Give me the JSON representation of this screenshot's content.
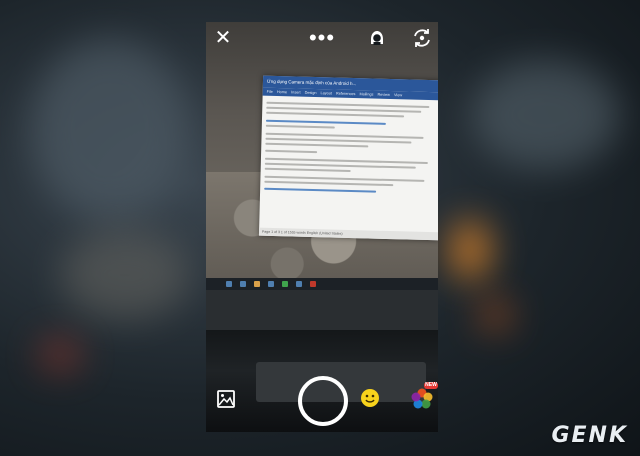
{
  "document_preview": {
    "title": "Ứng dụng Camera mặc định của Android h...",
    "menu_items": [
      "File",
      "Home",
      "Insert",
      "Design",
      "Layout",
      "References",
      "Mailings",
      "Review",
      "View"
    ],
    "status": "Page 1 of 3   1 of 1555 words   English (United States)"
  },
  "controls": {
    "close": "close-icon",
    "more": "more-dots-icon",
    "face": "face-filter-icon",
    "flip": "flip-camera-icon",
    "gallery": "gallery-icon",
    "emoji": "emoji-icon",
    "effects": "effects-icon",
    "new_badge": "NEW"
  },
  "watermark": "GENK",
  "colors": {
    "accent": "#ffffff",
    "badge": "#e53935",
    "emoji": "#f7d21c"
  }
}
